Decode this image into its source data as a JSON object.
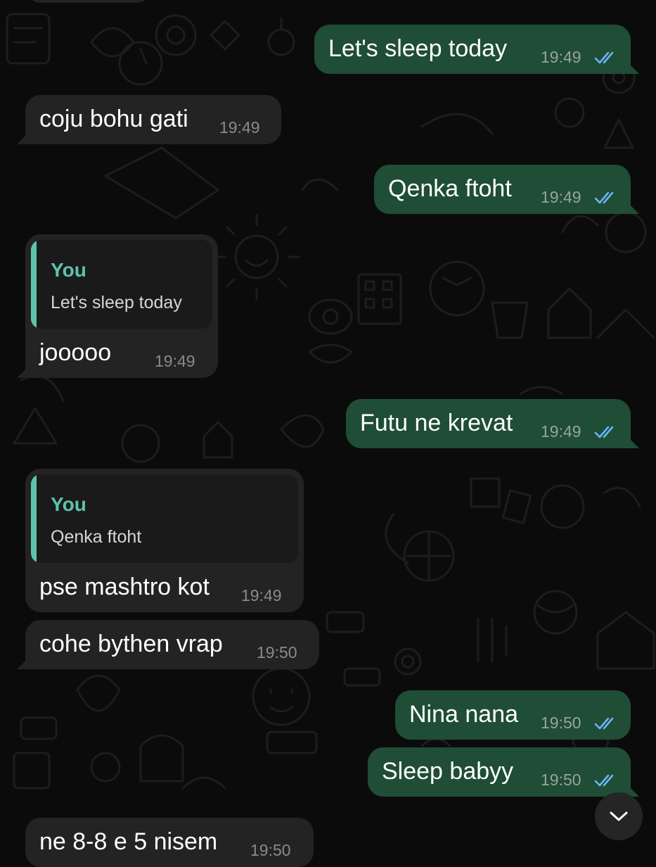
{
  "colors": {
    "background": "#0b0b0b",
    "outgoing_bubble": "#1f4d36",
    "incoming_bubble": "#232323",
    "quote_accent": "#5ec3ad",
    "read_ticks": "#6cb6ff"
  },
  "messages": [
    {
      "direction": "incoming",
      "text": "",
      "time": "",
      "partial": "top-cut"
    },
    {
      "direction": "outgoing",
      "text": "Let's sleep today",
      "time": "19:49",
      "status": "read"
    },
    {
      "direction": "incoming",
      "text": "coju bohu gati",
      "time": "19:49"
    },
    {
      "direction": "outgoing",
      "text": "Qenka ftoht",
      "time": "19:49",
      "status": "read"
    },
    {
      "direction": "incoming",
      "text": "jooooo",
      "time": "19:49",
      "reply_to": {
        "author": "You",
        "text": "Let's sleep today"
      }
    },
    {
      "direction": "outgoing",
      "text": "Futu ne krevat",
      "time": "19:49",
      "status": "read"
    },
    {
      "direction": "incoming",
      "text": "pse mashtro kot",
      "time": "19:49",
      "reply_to": {
        "author": "You",
        "text": "Qenka ftoht"
      }
    },
    {
      "direction": "incoming",
      "text": "cohe bythen vrap",
      "time": "19:50"
    },
    {
      "direction": "outgoing",
      "text": "Nina nana",
      "time": "19:50",
      "status": "read"
    },
    {
      "direction": "outgoing",
      "text": "Sleep babyy",
      "time": "19:50",
      "status": "read"
    },
    {
      "direction": "incoming",
      "text": "ne 8-8 e 5 nisem",
      "time": "19:50",
      "partial": "bottom-cut"
    }
  ],
  "scroll_button": {
    "icon": "chevron-down-icon"
  }
}
